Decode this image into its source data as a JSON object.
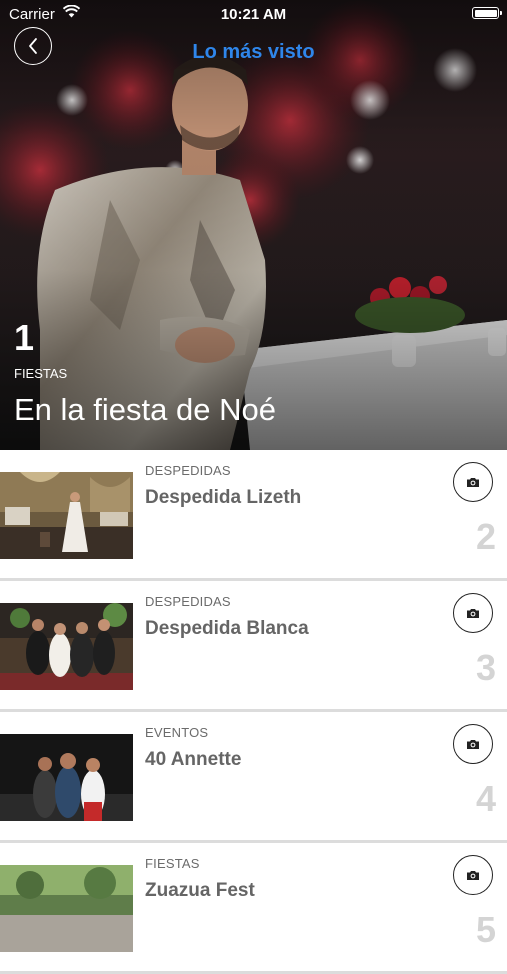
{
  "status_bar": {
    "carrier": "Carrier",
    "time": "10:21 AM"
  },
  "nav": {
    "title": "Lo más visto"
  },
  "hero": {
    "rank": "1",
    "category": "FIESTAS",
    "title": "En la fiesta de Noé"
  },
  "items": [
    {
      "category": "DESPEDIDAS",
      "title": "Despedida Lizeth",
      "rank": "2"
    },
    {
      "category": "DESPEDIDAS",
      "title": "Despedida Blanca",
      "rank": "3"
    },
    {
      "category": "EVENTOS",
      "title": "40 Annette",
      "rank": "4"
    },
    {
      "category": "FIESTAS",
      "title": "Zuazua Fest",
      "rank": "5"
    }
  ],
  "icons": {
    "back": "chevron-left-icon",
    "camera": "camera-icon",
    "wifi": "wifi-icon",
    "battery": "battery-icon"
  },
  "colors": {
    "nav_title": "#2f86ea",
    "rank_muted": "#d4d4d4",
    "divider": "#dcdcdc"
  }
}
